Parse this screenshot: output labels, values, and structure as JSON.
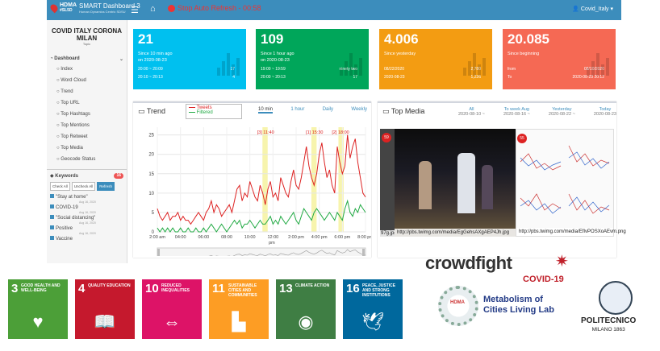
{
  "header": {
    "logo_top": "HDMA",
    "logo_sub": "#SL5D",
    "app_title": "SMART Dashboard 3",
    "app_subtitle": "Human Dynamics Centric SDSU",
    "stop_label": "Stop Auto Refresh - 00:58",
    "user": "Covid_Italy"
  },
  "sidebar": {
    "title": "COVID ITALY CORONA MILAN",
    "topic": "Topic",
    "dashboard": "Dashboard",
    "items": [
      "Index",
      "Word Cloud",
      "Trend",
      "Top URL",
      "Top Hashtags",
      "Top Mentions",
      "Top Retweet",
      "Top Media",
      "Geocode Status"
    ],
    "keywords_label": "Keywords",
    "keywords_count": "16",
    "btn_check": "Check All",
    "btn_uncheck": "Uncheck All",
    "btn_refresh": "Refresh",
    "keywords": [
      {
        "text": "\"Stay at home\"",
        "date": "Aug 16, 2020"
      },
      {
        "text": "COVID-19",
        "date": "Aug 16, 2020"
      },
      {
        "text": "\"Social distancing\"",
        "date": "Aug 16, 2020"
      },
      {
        "text": "Positive",
        "date": "Aug 16, 2020"
      },
      {
        "text": "Vaccine",
        "date": ""
      }
    ]
  },
  "cards": [
    {
      "big": "21",
      "sub1": "Since 10 min ago",
      "sub2": "on 2020-08-23",
      "r1a": "20:00 ~ 20:09",
      "r1b": "17",
      "r2a": "20:10 ~ 20:13",
      "r2b": "4",
      "color": "#00c0ef"
    },
    {
      "big": "109",
      "sub1": "Since 1 hour ago",
      "sub2": "on 2020-08-23",
      "r1a": "19:00 ~ 19:59",
      "r1b": "ninety two",
      "r2a": "20:00 ~ 20:13",
      "r2b": "17",
      "color": "#00a65a"
    },
    {
      "big": "4.006",
      "sub1": "Since yesterday",
      "sub2": "",
      "r1a": "08/22/2020",
      "r1b": "2,780",
      "r2a": "2020-08-23",
      "r2b": "1,226",
      "color": "#f39c12"
    },
    {
      "big": "20.085",
      "sub1": "Since beginning",
      "sub2": "",
      "r1a": "from",
      "r1b": "08/10/2020",
      "r2a": "To",
      "r2b": "2020-08-23 20:12",
      "color": "#f56954"
    }
  ],
  "trend": {
    "title": "Trend",
    "legend_tweets": "Tweets",
    "legend_filtered": "Filtered",
    "tabs": [
      "10 min",
      "1 hour",
      "Daily",
      "Weekly"
    ],
    "xaxis": [
      "2:00 am",
      "04:00",
      "06:00",
      "08:00",
      "10:00",
      "12:00",
      "2:00 pm",
      "4:00 pm",
      "6:00 pm",
      "8:00 pm"
    ],
    "xunit": "pm",
    "yaxis": [
      "0",
      "5",
      "10",
      "15",
      "20",
      "25"
    ],
    "annotations": [
      "[3] 11:40",
      "[1] 15:30",
      "[2] 18:00"
    ]
  },
  "chart_data": {
    "type": "line",
    "title": "Trend",
    "ylim": [
      0,
      27
    ],
    "series": [
      {
        "name": "Tweets",
        "color": "#dd2222",
        "values": [
          6,
          4,
          3,
          4,
          5,
          3,
          4,
          4,
          5,
          3,
          4,
          3,
          3,
          2,
          3,
          4,
          5,
          4,
          3,
          5,
          6,
          8,
          5,
          7,
          6,
          4,
          5,
          6,
          7,
          5,
          8,
          11,
          12,
          8,
          10,
          9,
          13,
          11,
          9,
          8,
          12,
          10,
          7,
          11,
          13,
          9,
          10,
          8,
          14,
          12,
          10,
          9,
          13,
          16,
          12,
          11,
          14,
          18,
          22,
          17,
          14,
          12,
          15,
          20,
          23,
          18,
          14,
          16,
          12,
          10,
          22,
          18,
          15,
          17,
          25,
          19,
          22,
          24,
          18,
          14,
          10,
          9
        ]
      },
      {
        "name": "Filtered",
        "color": "#22aa44",
        "values": [
          1,
          0,
          1,
          0,
          1,
          0,
          1,
          0,
          0,
          1,
          0,
          0,
          1,
          0,
          0,
          1,
          0,
          0,
          1,
          0,
          1,
          2,
          1,
          0,
          1,
          2,
          1,
          0,
          1,
          2,
          3,
          2,
          3,
          1,
          2,
          2,
          3,
          2,
          1,
          2,
          3,
          2,
          2,
          3,
          4,
          2,
          3,
          2,
          4,
          3,
          2,
          3,
          4,
          5,
          3,
          2,
          4,
          6,
          5,
          4,
          3,
          5,
          6,
          5,
          4,
          3,
          4,
          5,
          4,
          3,
          5,
          4,
          3,
          6,
          8,
          5,
          4,
          6,
          5,
          7,
          6,
          5
        ]
      }
    ]
  },
  "media": {
    "title": "Top Media",
    "tabs": [
      {
        "label": "All",
        "date": "2020-08-10 ~"
      },
      {
        "label": "To week Aug",
        "date": "2020-08-16 ~"
      },
      {
        "label": "Yesterday",
        "date": "2020-08-22 ~"
      },
      {
        "label": "Today",
        "date": "2020-08-23"
      }
    ],
    "items": [
      {
        "badge": "59",
        "url": "http://pbs.twimg.com/media/EgGehsAXgAEP4Jh.jpg"
      },
      {
        "badge": "55",
        "url": "http://pbs.twimg.com/media/EfIvPOSXoAEvm.png"
      }
    ],
    "left_url": "97g.jpg"
  },
  "sdgs": [
    {
      "num": "3",
      "label": "GOOD HEALTH AND WELL-BEING",
      "color": "#4c9f38",
      "glyph": "♥"
    },
    {
      "num": "4",
      "label": "QUALITY EDUCATION",
      "color": "#c5192d",
      "glyph": "📖"
    },
    {
      "num": "10",
      "label": "REDUCED INEQUALITIES",
      "color": "#dd1367",
      "glyph": "⇔"
    },
    {
      "num": "11",
      "label": "SUSTAINABLE CITIES AND COMMUNITIES",
      "color": "#fd9d24",
      "glyph": "▙"
    },
    {
      "num": "13",
      "label": "CLIMATE ACTION",
      "color": "#3f7e44",
      "glyph": "◉"
    },
    {
      "num": "16",
      "label": "PEACE, JUSTICE AND STRONG INSTITUTIONS",
      "color": "#00689d",
      "glyph": "🕊"
    }
  ],
  "logos": {
    "crowdfight": "crowdfight",
    "covid": "COVID-19",
    "mcl1": "Metabolism of",
    "mcl2": "Cities Living Lab",
    "polimi": "POLITECNICO",
    "polimi_sub": "MILANO 1863"
  }
}
